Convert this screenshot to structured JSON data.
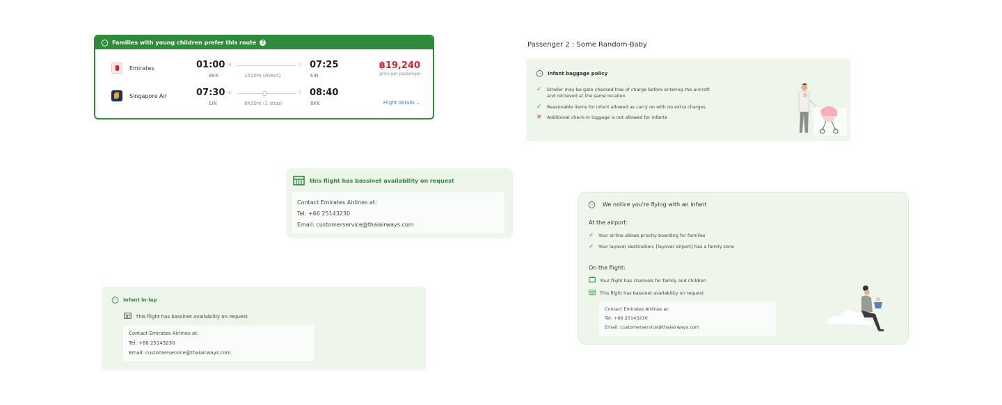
{
  "route_card": {
    "banner": "Families with young children prefer this route",
    "help_glyph": "?",
    "legs": [
      {
        "airline": "Emirates",
        "dep_time": "01:00",
        "dep_code": "BKK",
        "duration": "1h10m (direct)",
        "arr_time": "07:25",
        "arr_code": "EIN"
      },
      {
        "airline": "Singapore Air",
        "dep_time": "07:30",
        "dep_code": "EIN",
        "duration": "9h30m (1 stop)",
        "arr_time": "08:40",
        "arr_code": "BKK"
      }
    ],
    "price": "฿19,240",
    "price_note": "price per passenger",
    "details_link": "Flight details ⌄"
  },
  "passenger": {
    "title": "Passenger 2 : Some Random-Baby"
  },
  "baggage_policy": {
    "heading": "Infant baggage policy",
    "items": [
      {
        "status": "allowed",
        "line1": "Stroller may be gate checked free of charge before entering the aircraft",
        "line2": "and retrieved at the same location"
      },
      {
        "status": "allowed",
        "line1": "Reasonable items for infant allowed as carry on with no extra charges",
        "line2": ""
      },
      {
        "status": "not-allowed",
        "line1": "Additional check-in luggage is not allowed for infants",
        "line2": ""
      }
    ]
  },
  "bassinet_card": {
    "heading": "this flight has bassinet availability on request",
    "contact_title": "Contact Emirates Airlines at:",
    "tel": "Tel: +66 25143230",
    "email": "Email: customerservice@thaiairways.com"
  },
  "infant_in_lap": {
    "heading": "Infant in-lap",
    "bassinet_note": "This flight has bassinet availability on request",
    "contact_title": "Contact Emirates Airlines at:",
    "tel": "Tel: +66 25143230",
    "email": "Email: customerservice@thaiairways.com"
  },
  "infant_notice": {
    "heading": "We notice you're flying with an infant",
    "airport_title": "At the airport:",
    "airport_items": [
      "Your airline allows priority boarding for families",
      "Your layover destination, [layover airport] has a family zone"
    ],
    "flight_title": "On the flight:",
    "flight_items": [
      "Your flight has channels for family and children",
      "This flight has bassinet availability on request"
    ],
    "contact_title": "Contact Emirates Airlines at:",
    "tel": "Tel: +66 25143230",
    "email": "Email: customerservice@thaiairways.com"
  },
  "colors": {
    "brand_green": "#2e8b3a",
    "panel_green": "#eef5ea",
    "price_red": "#d9262f",
    "link_blue": "#3a7bd5"
  },
  "icons": {
    "baby": "baby-face-icon",
    "help": "question-circle-icon",
    "plane": "plane-icon",
    "pin": "location-pin-icon",
    "check": "check-icon",
    "cross": "cross-icon",
    "crib": "bassinet-icon",
    "tv": "tv-icon"
  }
}
